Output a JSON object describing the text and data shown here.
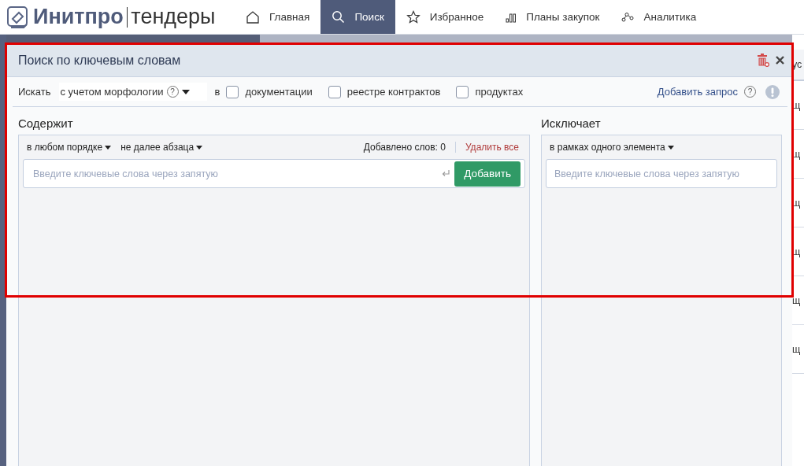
{
  "logo": {
    "brand": "Инитпро",
    "product": "тендеры"
  },
  "nav": [
    {
      "label": "Главная",
      "kind": "home",
      "selected": false
    },
    {
      "label": "Поиск",
      "kind": "search",
      "selected": true
    },
    {
      "label": "Избранное",
      "kind": "favorites",
      "selected": false
    },
    {
      "label": "Планы закупок",
      "kind": "plans",
      "selected": false
    },
    {
      "label": "Аналитика",
      "kind": "analytics",
      "selected": false
    }
  ],
  "dialog": {
    "title": "Поиск по ключевым словам",
    "search_label": "Искать",
    "search_mode": "с учетом морфологии",
    "search_help": "?",
    "in_label": "в",
    "scopes": [
      {
        "label": "документации",
        "checked": false
      },
      {
        "label": "реестре контрактов",
        "checked": false
      },
      {
        "label": "продуктах",
        "checked": false
      }
    ],
    "add_query": "Добавить запрос",
    "add_query_help": "?",
    "contains": {
      "heading": "Содержит",
      "order": "в любом порядке",
      "distance": "не далее абзаца",
      "count": "Добавлено слов: 0",
      "delete_all": "Удалить все",
      "placeholder": "Введите ключевые слова через запятую",
      "add_button": "Добавить"
    },
    "excludes": {
      "heading": "Исключает",
      "scope": "в рамках одного элемента",
      "placeholder": "Введите ключевые слова через запятую"
    }
  },
  "background_table": {
    "header": "ус",
    "cells": [
      "щ",
      "щ",
      "щ",
      "щ",
      "щ",
      "щ"
    ]
  }
}
